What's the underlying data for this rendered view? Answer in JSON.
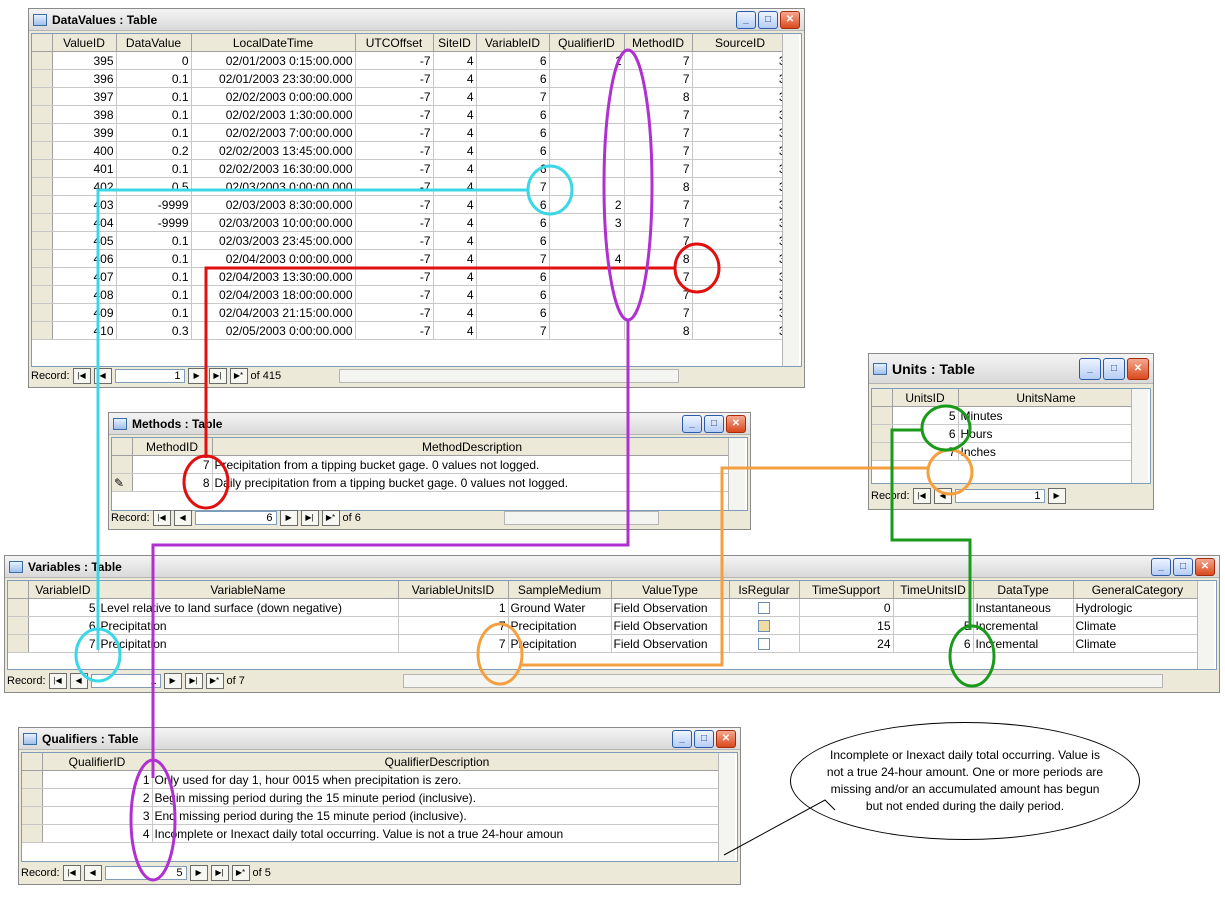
{
  "datavalues": {
    "title": "DataValues : Table",
    "columns": [
      "ValueID",
      "DataValue",
      "LocalDateTime",
      "UTCOffset",
      "SiteID",
      "VariableID",
      "QualifierID",
      "MethodID",
      "SourceID"
    ],
    "rows": [
      [
        "395",
        "0",
        "02/01/2003 0:15:00.000",
        "-7",
        "4",
        "6",
        "1",
        "7",
        "3"
      ],
      [
        "396",
        "0.1",
        "02/01/2003 23:30:00.000",
        "-7",
        "4",
        "6",
        "",
        "7",
        "3"
      ],
      [
        "397",
        "0.1",
        "02/02/2003 0:00:00.000",
        "-7",
        "4",
        "7",
        "",
        "8",
        "3"
      ],
      [
        "398",
        "0.1",
        "02/02/2003 1:30:00.000",
        "-7",
        "4",
        "6",
        "",
        "7",
        "3"
      ],
      [
        "399",
        "0.1",
        "02/02/2003 7:00:00.000",
        "-7",
        "4",
        "6",
        "",
        "7",
        "3"
      ],
      [
        "400",
        "0.2",
        "02/02/2003 13:45:00.000",
        "-7",
        "4",
        "6",
        "",
        "7",
        "3"
      ],
      [
        "401",
        "0.1",
        "02/02/2003 16:30:00.000",
        "-7",
        "4",
        "6",
        "",
        "7",
        "3"
      ],
      [
        "402",
        "0.5",
        "02/03/2003 0:00:00.000",
        "-7",
        "4",
        "7",
        "",
        "8",
        "3"
      ],
      [
        "403",
        "-9999",
        "02/03/2003 8:30:00.000",
        "-7",
        "4",
        "6",
        "2",
        "7",
        "3"
      ],
      [
        "404",
        "-9999",
        "02/03/2003 10:00:00.000",
        "-7",
        "4",
        "6",
        "3",
        "7",
        "3"
      ],
      [
        "405",
        "0.1",
        "02/03/2003 23:45:00.000",
        "-7",
        "4",
        "6",
        "",
        "7",
        "3"
      ],
      [
        "406",
        "0.1",
        "02/04/2003 0:00:00.000",
        "-7",
        "4",
        "7",
        "4",
        "8",
        "3"
      ],
      [
        "407",
        "0.1",
        "02/04/2003 13:30:00.000",
        "-7",
        "4",
        "6",
        "",
        "7",
        "3"
      ],
      [
        "408",
        "0.1",
        "02/04/2003 18:00:00.000",
        "-7",
        "4",
        "6",
        "",
        "7",
        "3"
      ],
      [
        "409",
        "0.1",
        "02/04/2003 21:15:00.000",
        "-7",
        "4",
        "6",
        "",
        "7",
        "3"
      ],
      [
        "410",
        "0.3",
        "02/05/2003 0:00:00.000",
        "-7",
        "4",
        "7",
        "",
        "8",
        "3"
      ]
    ],
    "record_label": "Record:",
    "record_current": "1",
    "record_of": "of 415"
  },
  "methods": {
    "title": "Methods : Table",
    "columns": [
      "MethodID",
      "MethodDescription"
    ],
    "rows": [
      [
        "7",
        "Precipitation from a tipping bucket gage.  0 values not logged."
      ],
      [
        "8",
        "Daily precipitation from a tipping bucket gage.  0 values not logged."
      ]
    ],
    "record_label": "Record:",
    "record_current": "6",
    "record_of": "of 6"
  },
  "units": {
    "title": "Units : Table",
    "columns": [
      "UnitsID",
      "UnitsName"
    ],
    "rows": [
      [
        "5",
        "Minutes"
      ],
      [
        "6",
        "Hours"
      ],
      [
        "7",
        "Inches"
      ]
    ],
    "record_label": "Record:",
    "record_current": "1"
  },
  "variables": {
    "title": "Variables : Table",
    "columns": [
      "VariableID",
      "VariableName",
      "VariableUnitsID",
      "SampleMedium",
      "ValueType",
      "IsRegular",
      "TimeSupport",
      "TimeUnitsID",
      "DataType",
      "GeneralCategory"
    ],
    "rows": [
      [
        "5",
        "Level relative to land surface (down negative)",
        "1",
        "Ground Water",
        "Field Observation",
        "",
        "0",
        "",
        "Instantaneous",
        "Hydrologic"
      ],
      [
        "6",
        "Precipitation",
        "7",
        "Precipitation",
        "Field Observation",
        "on",
        "15",
        "5",
        "Incremental",
        "Climate"
      ],
      [
        "7",
        "Precipitation",
        "7",
        "Precipitation",
        "Field Observation",
        "",
        "24",
        "6",
        "Incremental",
        "Climate"
      ]
    ],
    "record_label": "Record:",
    "record_current": "1",
    "record_of": "of 7"
  },
  "qualifiers": {
    "title": "Qualifiers : Table",
    "columns": [
      "QualifierID",
      "QualifierDescription"
    ],
    "rows": [
      [
        "1",
        "Only used for day 1, hour 0015 when precipitation is zero."
      ],
      [
        "2",
        "Begin missing period during the 15 minute period (inclusive)."
      ],
      [
        "3",
        "End missing period during the 15 minute period (inclusive)."
      ],
      [
        "4",
        "Incomplete or Inexact daily total occurring.  Value is not a true 24-hour amoun"
      ]
    ],
    "record_label": "Record:",
    "record_current": "5",
    "record_of": "of 5"
  },
  "callout": {
    "text": "Incomplete or Inexact daily total occurring. Value is not a true 24-hour amount.  One or more periods are missing and/or an accumulated amount has begun but not ended during the daily period."
  },
  "colors": {
    "cyan": "#3cd7e6",
    "red": "#e01010",
    "magenta": "#b030d0",
    "orange": "#f5a040",
    "green": "#1a9a1a"
  },
  "icons": [
    "table-icon",
    "minimize-icon",
    "maximize-icon",
    "close-icon",
    "first-record-icon",
    "prev-record-icon",
    "next-record-icon",
    "last-record-icon",
    "new-record-icon",
    "pencil-icon",
    "scroll-up-icon",
    "scroll-down-icon"
  ]
}
